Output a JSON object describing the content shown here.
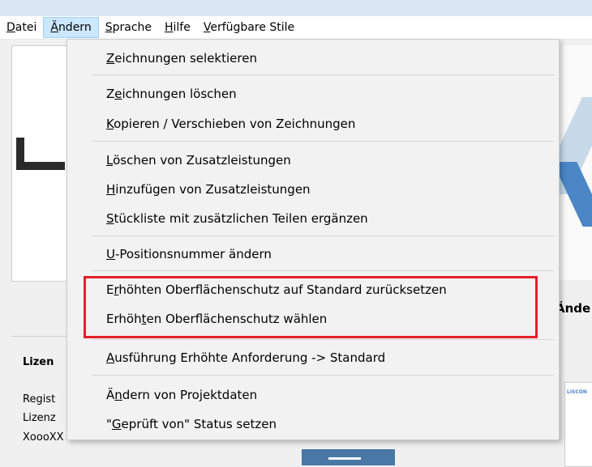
{
  "menubar": {
    "items": [
      {
        "label": "Datei"
      },
      {
        "label": "Ändern"
      },
      {
        "label": "Sprache"
      },
      {
        "label": "Hilfe"
      },
      {
        "label": "Verfügbare Stile"
      }
    ]
  },
  "background": {
    "section_title": "Ände",
    "lizenz_label": "Lizen",
    "regist_label": "Regist",
    "lizenz2_label": "Lizenz",
    "xooo_label": "XoooXX",
    "card_label": "LISCON"
  },
  "dropdown": {
    "items": [
      {
        "label": "Zeichnungen selektieren",
        "mnemonic": "Z"
      },
      {
        "label": "Zeichnungen löschen",
        "mnemonic": "e"
      },
      {
        "label": "Kopieren / Verschieben von Zeichnungen",
        "mnemonic": "K"
      },
      {
        "label": "Löschen von Zusatzleistungen",
        "mnemonic": "L"
      },
      {
        "label": "Hinzufügen von Zusatzleistungen",
        "mnemonic": "H"
      },
      {
        "label": "Stückliste mit zusätzlichen Teilen ergänzen",
        "mnemonic": "S"
      },
      {
        "label": "U-Positionsnummer ändern",
        "mnemonic": "U"
      },
      {
        "label": "Erhöhten Oberflächenschutz auf Standard zurücksetzen",
        "mnemonic": "r"
      },
      {
        "label": "Erhöhten Oberflächenschutz wählen",
        "mnemonic": "t"
      },
      {
        "label": "Ausführung Erhöhte Anforderung -> Standard",
        "mnemonic": "A"
      },
      {
        "label": "Ändern von Projektdaten",
        "mnemonic": "n"
      },
      {
        "label": "\"Geprüft von\" Status setzen",
        "mnemonic": "G"
      }
    ]
  },
  "highlight_color": "#e4202a",
  "menu_active_color": "#cce8ff"
}
